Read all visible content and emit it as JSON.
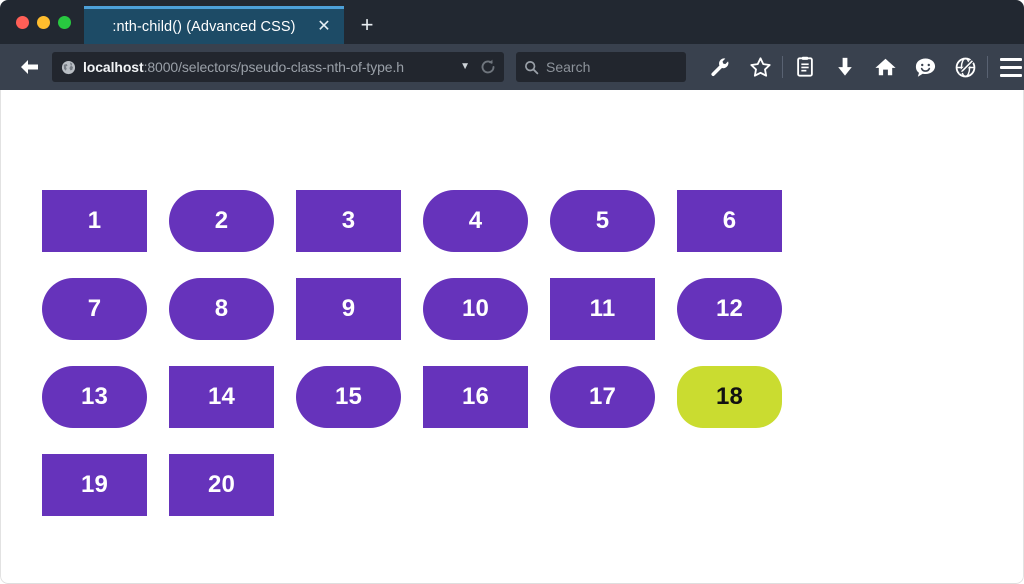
{
  "window": {
    "traffic_lights": [
      {
        "name": "close",
        "color": "#ff5f57"
      },
      {
        "name": "minimize",
        "color": "#ffbd2e"
      },
      {
        "name": "maximize",
        "color": "#28c840"
      }
    ]
  },
  "tabbar": {
    "tab_title": ":nth-child() (Advanced CSS)",
    "close_glyph": "✕",
    "new_tab_glyph": "+"
  },
  "toolbar": {
    "back_icon": "arrow-left-icon",
    "url_host": "localhost",
    "url_rest": ":8000/selectors/pseudo-class-nth-of-type.h",
    "url_full": "localhost:8000/selectors/pseudo-class-nth-of-type.h",
    "url_caret_glyph": "▼",
    "reload_icon": "reload-icon",
    "search_placeholder": "Search",
    "icons": [
      {
        "name": "wrench-icon",
        "label": "Developer Tools"
      },
      {
        "name": "star-icon",
        "label": "Bookmark"
      },
      {
        "name": "reader-icon",
        "label": "Reader View"
      },
      {
        "name": "download-icon",
        "label": "Downloads"
      },
      {
        "name": "home-icon",
        "label": "Home"
      },
      {
        "name": "smiley-chat-icon",
        "label": "Feedback"
      },
      {
        "name": "pocket-globe-icon",
        "label": "Save to Pocket"
      }
    ],
    "menu_icon": "hamburger-menu-icon"
  },
  "colors": {
    "shape_default_bg": "#6633bb",
    "shape_default_text": "#ffffff",
    "shape_target_bg": "#cadc30",
    "shape_target_text": "#111111",
    "tab_active_bg": "#1d4b66",
    "tab_accent": "#4da0d8",
    "tabstrip_bg": "#222831",
    "toolbar_bg": "#39414e",
    "urlbar_bg": "#22262e",
    "page_bg": "#ffffff"
  },
  "page": {
    "shapes": [
      {
        "label": "1",
        "shape": "rect",
        "highlighted": false
      },
      {
        "label": "2",
        "shape": "pill",
        "highlighted": false
      },
      {
        "label": "3",
        "shape": "rect",
        "highlighted": false
      },
      {
        "label": "4",
        "shape": "pill",
        "highlighted": false
      },
      {
        "label": "5",
        "shape": "pill",
        "highlighted": false
      },
      {
        "label": "6",
        "shape": "rect",
        "highlighted": false
      },
      {
        "label": "7",
        "shape": "pill",
        "highlighted": false
      },
      {
        "label": "8",
        "shape": "pill",
        "highlighted": false
      },
      {
        "label": "9",
        "shape": "rect",
        "highlighted": false
      },
      {
        "label": "10",
        "shape": "pill",
        "highlighted": false
      },
      {
        "label": "11",
        "shape": "rect",
        "highlighted": false
      },
      {
        "label": "12",
        "shape": "pill",
        "highlighted": false
      },
      {
        "label": "13",
        "shape": "pill",
        "highlighted": false
      },
      {
        "label": "14",
        "shape": "rect",
        "highlighted": false
      },
      {
        "label": "15",
        "shape": "pill",
        "highlighted": false
      },
      {
        "label": "16",
        "shape": "rect",
        "highlighted": false
      },
      {
        "label": "17",
        "shape": "pill",
        "highlighted": false
      },
      {
        "label": "18",
        "shape": "pill",
        "highlighted": true
      },
      {
        "label": "19",
        "shape": "rect",
        "highlighted": false
      },
      {
        "label": "20",
        "shape": "rect",
        "highlighted": false
      }
    ]
  }
}
